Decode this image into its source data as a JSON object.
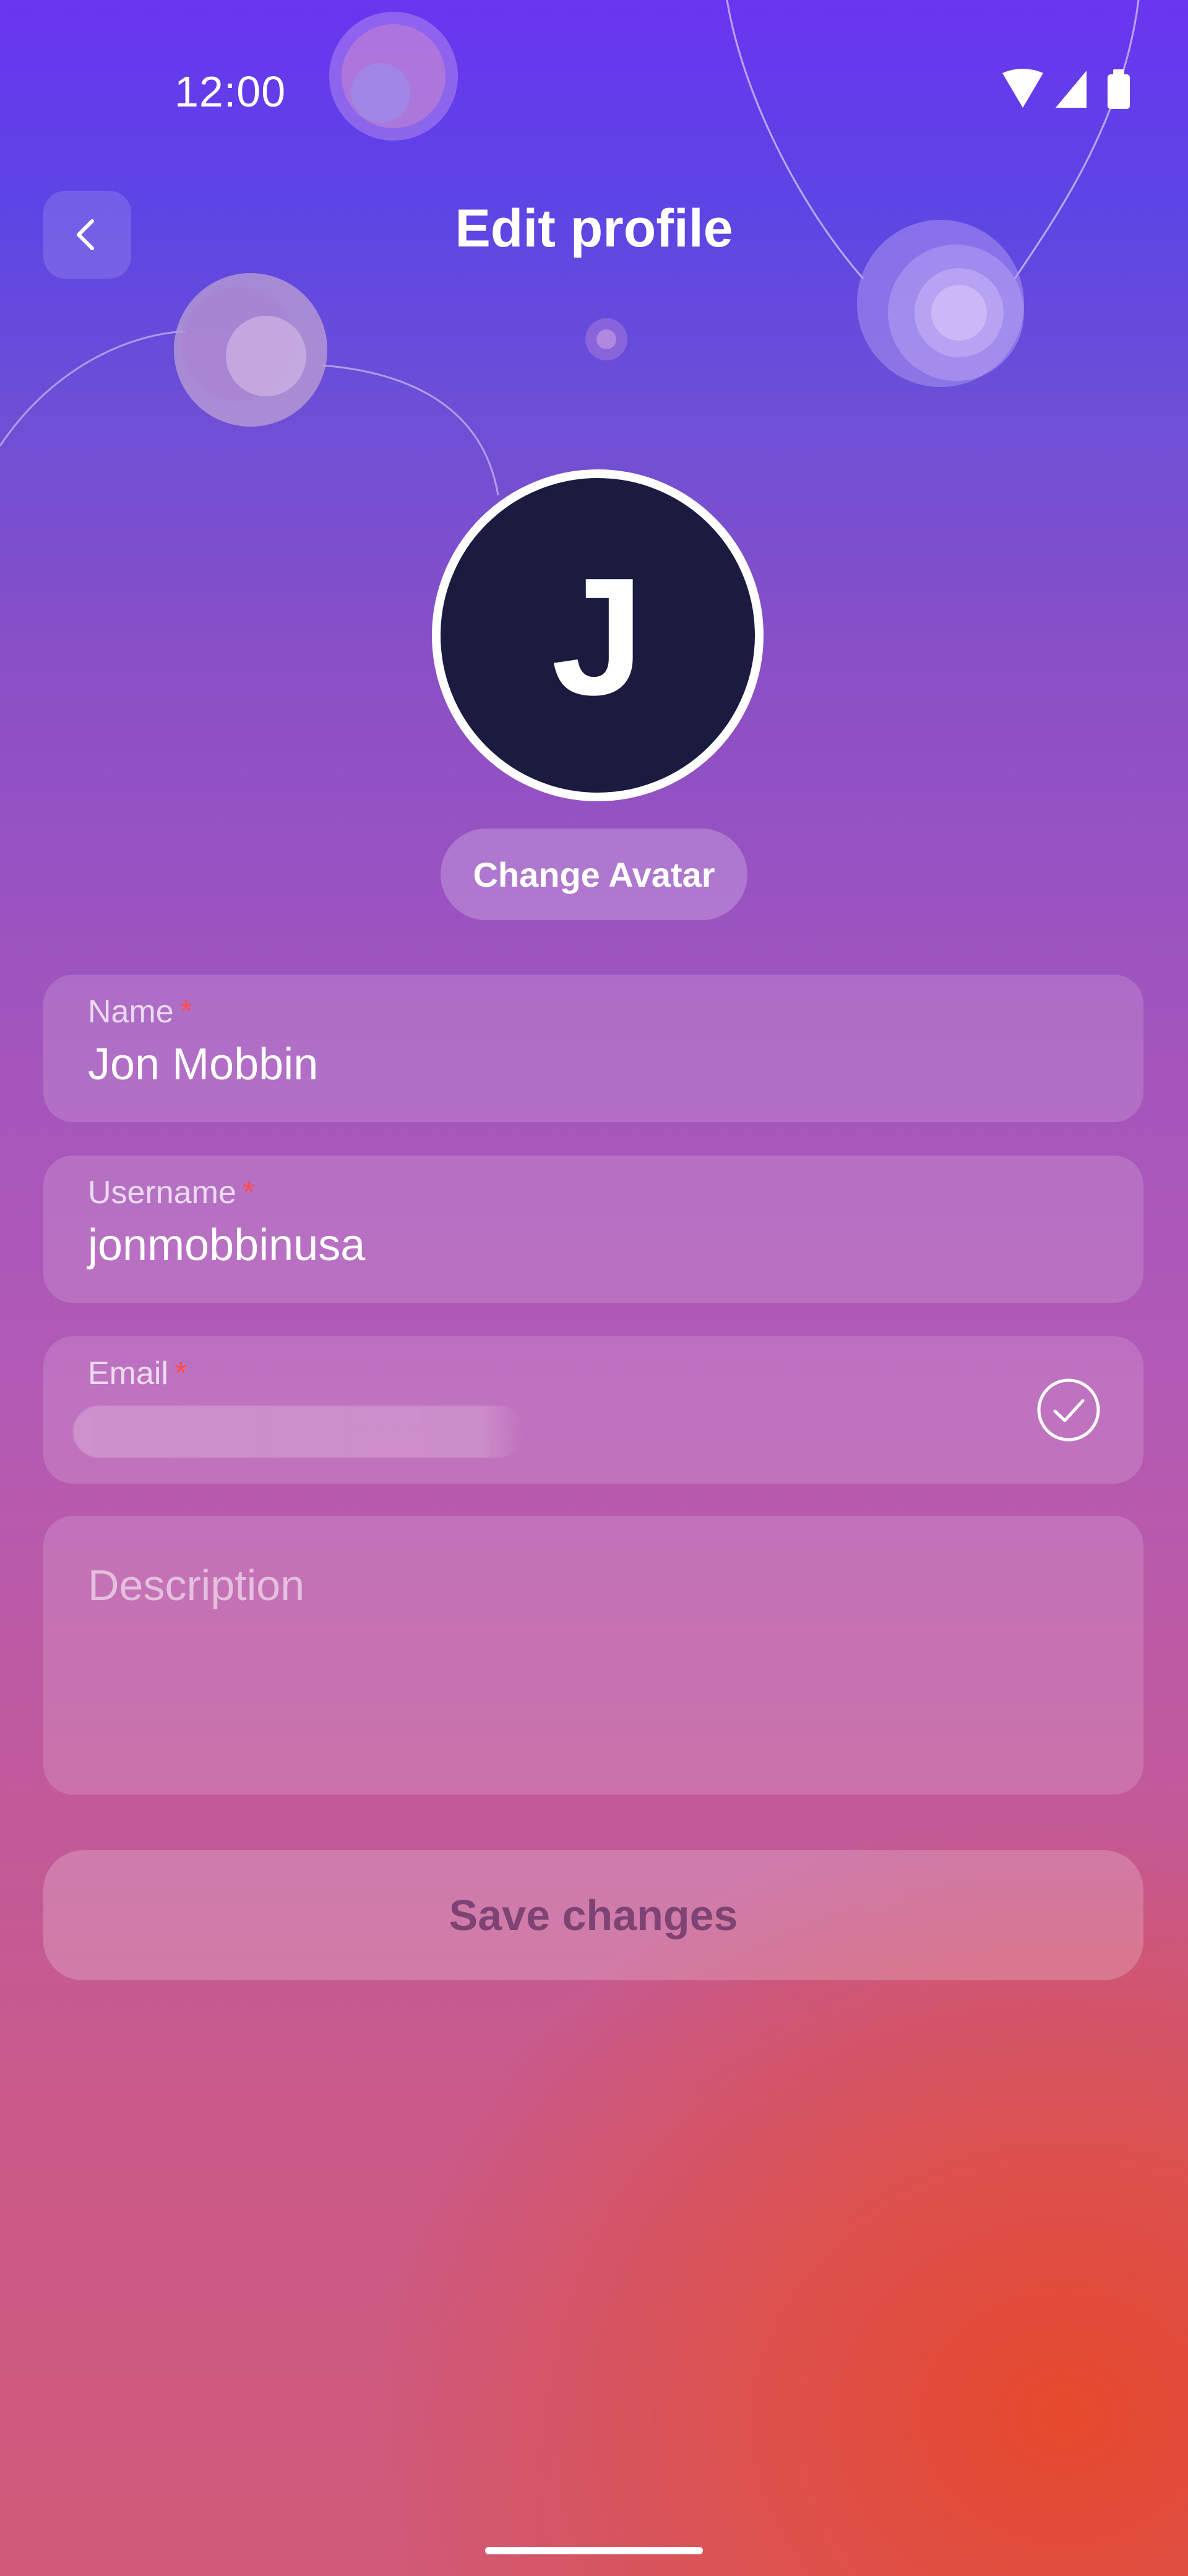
{
  "status_bar": {
    "time": "12:00"
  },
  "header": {
    "title": "Edit profile",
    "back_icon": "chevron-left-icon"
  },
  "avatar": {
    "initial": "J",
    "background_color": "#1a1b3f",
    "change_label": "Change Avatar"
  },
  "form": {
    "name": {
      "label": "Name",
      "required_mark": "*",
      "value": "Jon Mobbin"
    },
    "username": {
      "label": "Username",
      "required_mark": "*",
      "value": "jonmobbinusa"
    },
    "email": {
      "label": "Email",
      "required_mark": "*",
      "verified_icon": "check-circle-icon"
    },
    "description": {
      "placeholder": "Description"
    }
  },
  "actions": {
    "save_label": "Save changes"
  },
  "colors": {
    "accent_top": "#6a35f0",
    "accent_bottom": "#e84828",
    "required": "#ff4d4d"
  }
}
